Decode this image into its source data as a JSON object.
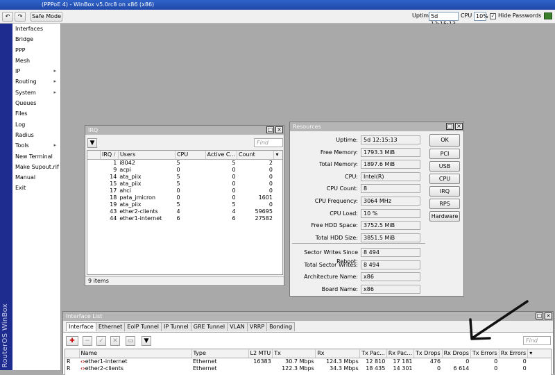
{
  "window": {
    "title": "(PPPoE 4) - WinBox v5.0rc8 on x86 (x86)"
  },
  "toolbar": {
    "safe_mode": "Safe Mode",
    "uptime_label": "Uptime",
    "uptime_value": "5d 12:15:13",
    "cpu_label": "CPU",
    "cpu_value": "10%",
    "hide_passwords": "Hide Passwords",
    "hide_passwords_checked": "✓"
  },
  "brand_strip": "RouterOS WinBox",
  "menu": [
    {
      "label": "Interfaces",
      "arrow": ""
    },
    {
      "label": "Bridge",
      "arrow": ""
    },
    {
      "label": "PPP",
      "arrow": ""
    },
    {
      "label": "Mesh",
      "arrow": ""
    },
    {
      "label": "IP",
      "arrow": "▸"
    },
    {
      "label": "Routing",
      "arrow": "▸"
    },
    {
      "label": "System",
      "arrow": "▸"
    },
    {
      "label": "Queues",
      "arrow": ""
    },
    {
      "label": "Files",
      "arrow": ""
    },
    {
      "label": "Log",
      "arrow": ""
    },
    {
      "label": "Radius",
      "arrow": ""
    },
    {
      "label": "Tools",
      "arrow": "▸"
    },
    {
      "label": "New Terminal",
      "arrow": ""
    },
    {
      "label": "Make Supout.rif",
      "arrow": ""
    },
    {
      "label": "Manual",
      "arrow": ""
    },
    {
      "label": "Exit",
      "arrow": ""
    }
  ],
  "irq": {
    "title": "IRQ",
    "find_placeholder": "Find",
    "columns": [
      "IRQ",
      "Users",
      "CPU",
      "Active C...",
      "Count"
    ],
    "sort_indicator": "/",
    "rows": [
      {
        "irq": "1",
        "users": "i8042",
        "cpu": "5",
        "active": "5",
        "count": "2"
      },
      {
        "irq": "9",
        "users": "acpi",
        "cpu": "0",
        "active": "0",
        "count": "0"
      },
      {
        "irq": "14",
        "users": "ata_piix",
        "cpu": "5",
        "active": "0",
        "count": "0"
      },
      {
        "irq": "15",
        "users": "ata_piix",
        "cpu": "5",
        "active": "0",
        "count": "0"
      },
      {
        "irq": "17",
        "users": "ahci",
        "cpu": "0",
        "active": "0",
        "count": "0"
      },
      {
        "irq": "18",
        "users": "pata_jmicron",
        "cpu": "0",
        "active": "0",
        "count": "1601"
      },
      {
        "irq": "19",
        "users": "ata_piix",
        "cpu": "5",
        "active": "5",
        "count": "0"
      },
      {
        "irq": "43",
        "users": "ether2-clients",
        "cpu": "4",
        "active": "4",
        "count": "59695"
      },
      {
        "irq": "44",
        "users": "ether1-internet",
        "cpu": "6",
        "active": "6",
        "count": "27582"
      }
    ],
    "status": "9 items"
  },
  "resources": {
    "title": "Resources",
    "fields": [
      {
        "label": "Uptime:",
        "value": "5d 12:15:13"
      },
      {
        "label": "Free Memory:",
        "value": "1793.3 MiB"
      },
      {
        "label": "Total Memory:",
        "value": "1897.6 MiB"
      },
      {
        "label": "CPU:",
        "value": "Intel(R)"
      },
      {
        "label": "CPU Count:",
        "value": "8"
      },
      {
        "label": "CPU Frequency:",
        "value": "3064 MHz"
      },
      {
        "label": "CPU Load:",
        "value": "10 %"
      },
      {
        "label": "Free HDD Space:",
        "value": "3752.5 MiB"
      },
      {
        "label": "Total HDD Size:",
        "value": "3851.5 MiB"
      }
    ],
    "fields2": [
      {
        "label": "Sector Writes Since Reboot:",
        "value": "8 494"
      },
      {
        "label": "Total Sector Writes:",
        "value": "8 494"
      },
      {
        "label": "Architecture Name:",
        "value": "x86"
      },
      {
        "label": "Board Name:",
        "value": "x86"
      }
    ],
    "buttons": [
      "OK",
      "PCI",
      "USB",
      "CPU",
      "IRQ",
      "RPS",
      "Hardware"
    ]
  },
  "iface": {
    "title": "Interface List",
    "tabs": [
      "Interface",
      "Ethernet",
      "EoIP Tunnel",
      "IP Tunnel",
      "GRE Tunnel",
      "VLAN",
      "VRRP",
      "Bonding"
    ],
    "find_placeholder": "Find",
    "columns": [
      "Name",
      "Type",
      "L2 MTU",
      "Tx",
      "Rx",
      "Tx Pac...",
      "Rx Pac...",
      "Tx Drops",
      "Rx Drops",
      "Tx Errors",
      "Rx Errors"
    ],
    "rows": [
      {
        "flag": "R",
        "name": "ether1-internet",
        "type": "Ethernet",
        "l2mtu": "16383",
        "tx": "30.7 Mbps",
        "rx": "124.3 Mbps",
        "txp": "12 810",
        "rxp": "17 181",
        "txd": "476",
        "rxd": "0",
        "txe": "0",
        "rxe": "0"
      },
      {
        "flag": "R",
        "name": "ether2-clients",
        "type": "Ethernet",
        "l2mtu": "",
        "tx": "122.3 Mbps",
        "rx": "34.3 Mbps",
        "txp": "18 435",
        "rxp": "14 301",
        "txd": "0",
        "rxd": "6 614",
        "txe": "0",
        "rxe": "0"
      }
    ]
  },
  "colors": {
    "titlebar": "#2f63c9",
    "brand_strip": "#1e2c8f",
    "workspace": "#a9a9a9"
  }
}
